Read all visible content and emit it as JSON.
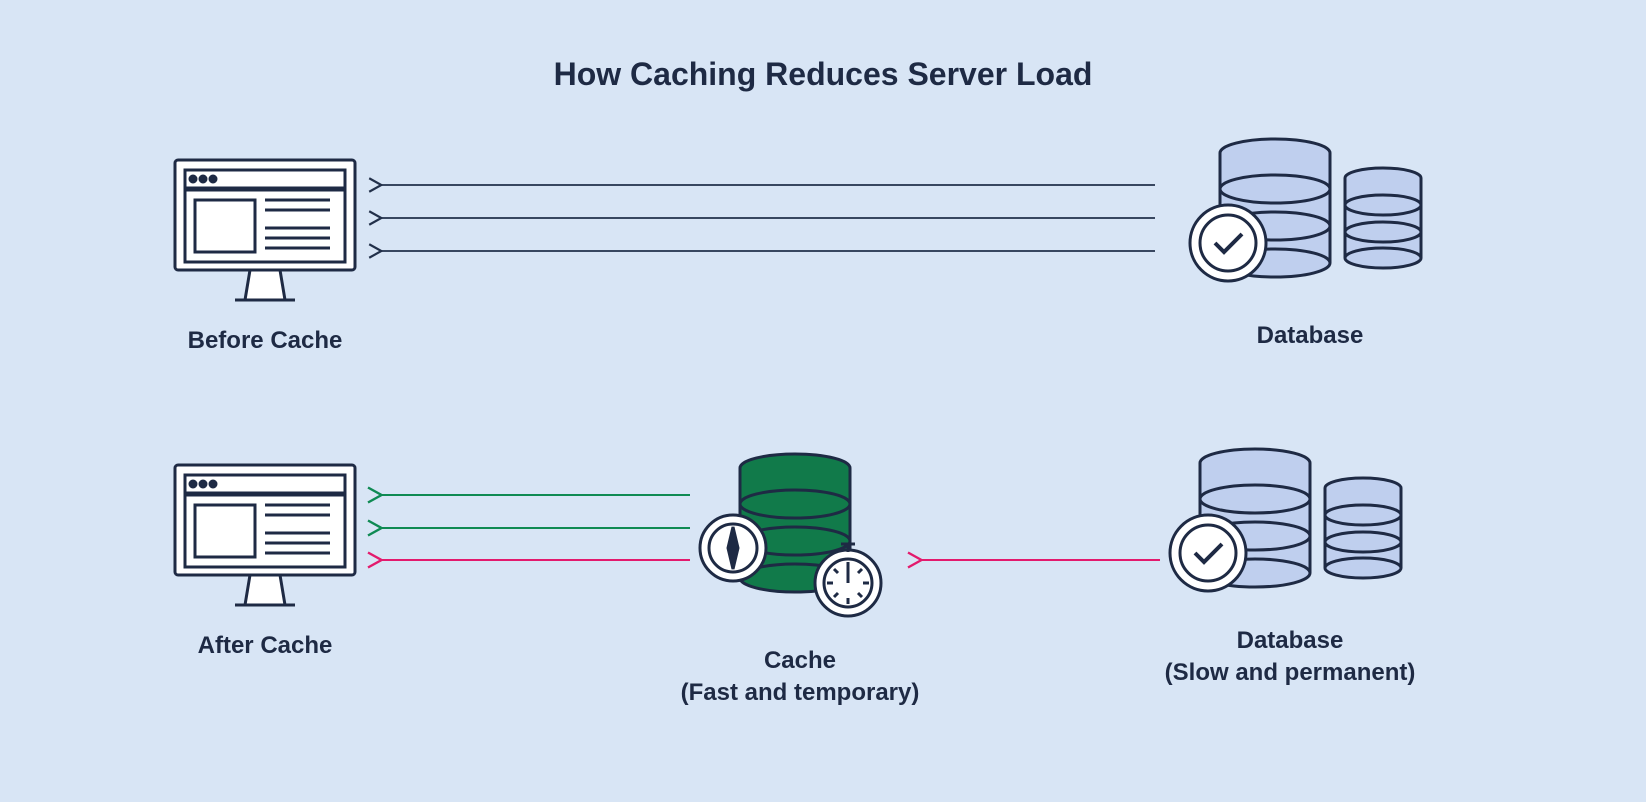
{
  "title": "How Caching Reduces Server Load",
  "labels": {
    "before_client": "Before Cache",
    "before_db": "Database",
    "after_client": "After Cache",
    "cache_line1": "Cache",
    "cache_line2": "(Fast and temporary)",
    "db2_line1": "Database",
    "db2_line2": "(Slow and permanent)"
  },
  "colors": {
    "bg": "#d8e5f5",
    "text": "#1e2a44",
    "stroke": "#1e2a44",
    "dbFill": "#bfcfee",
    "cacheFill": "#117a4a",
    "arrowBlack": "#22304a",
    "arrowGreen": "#0f8a53",
    "arrowPink": "#e31a6d",
    "white": "#ffffff"
  }
}
